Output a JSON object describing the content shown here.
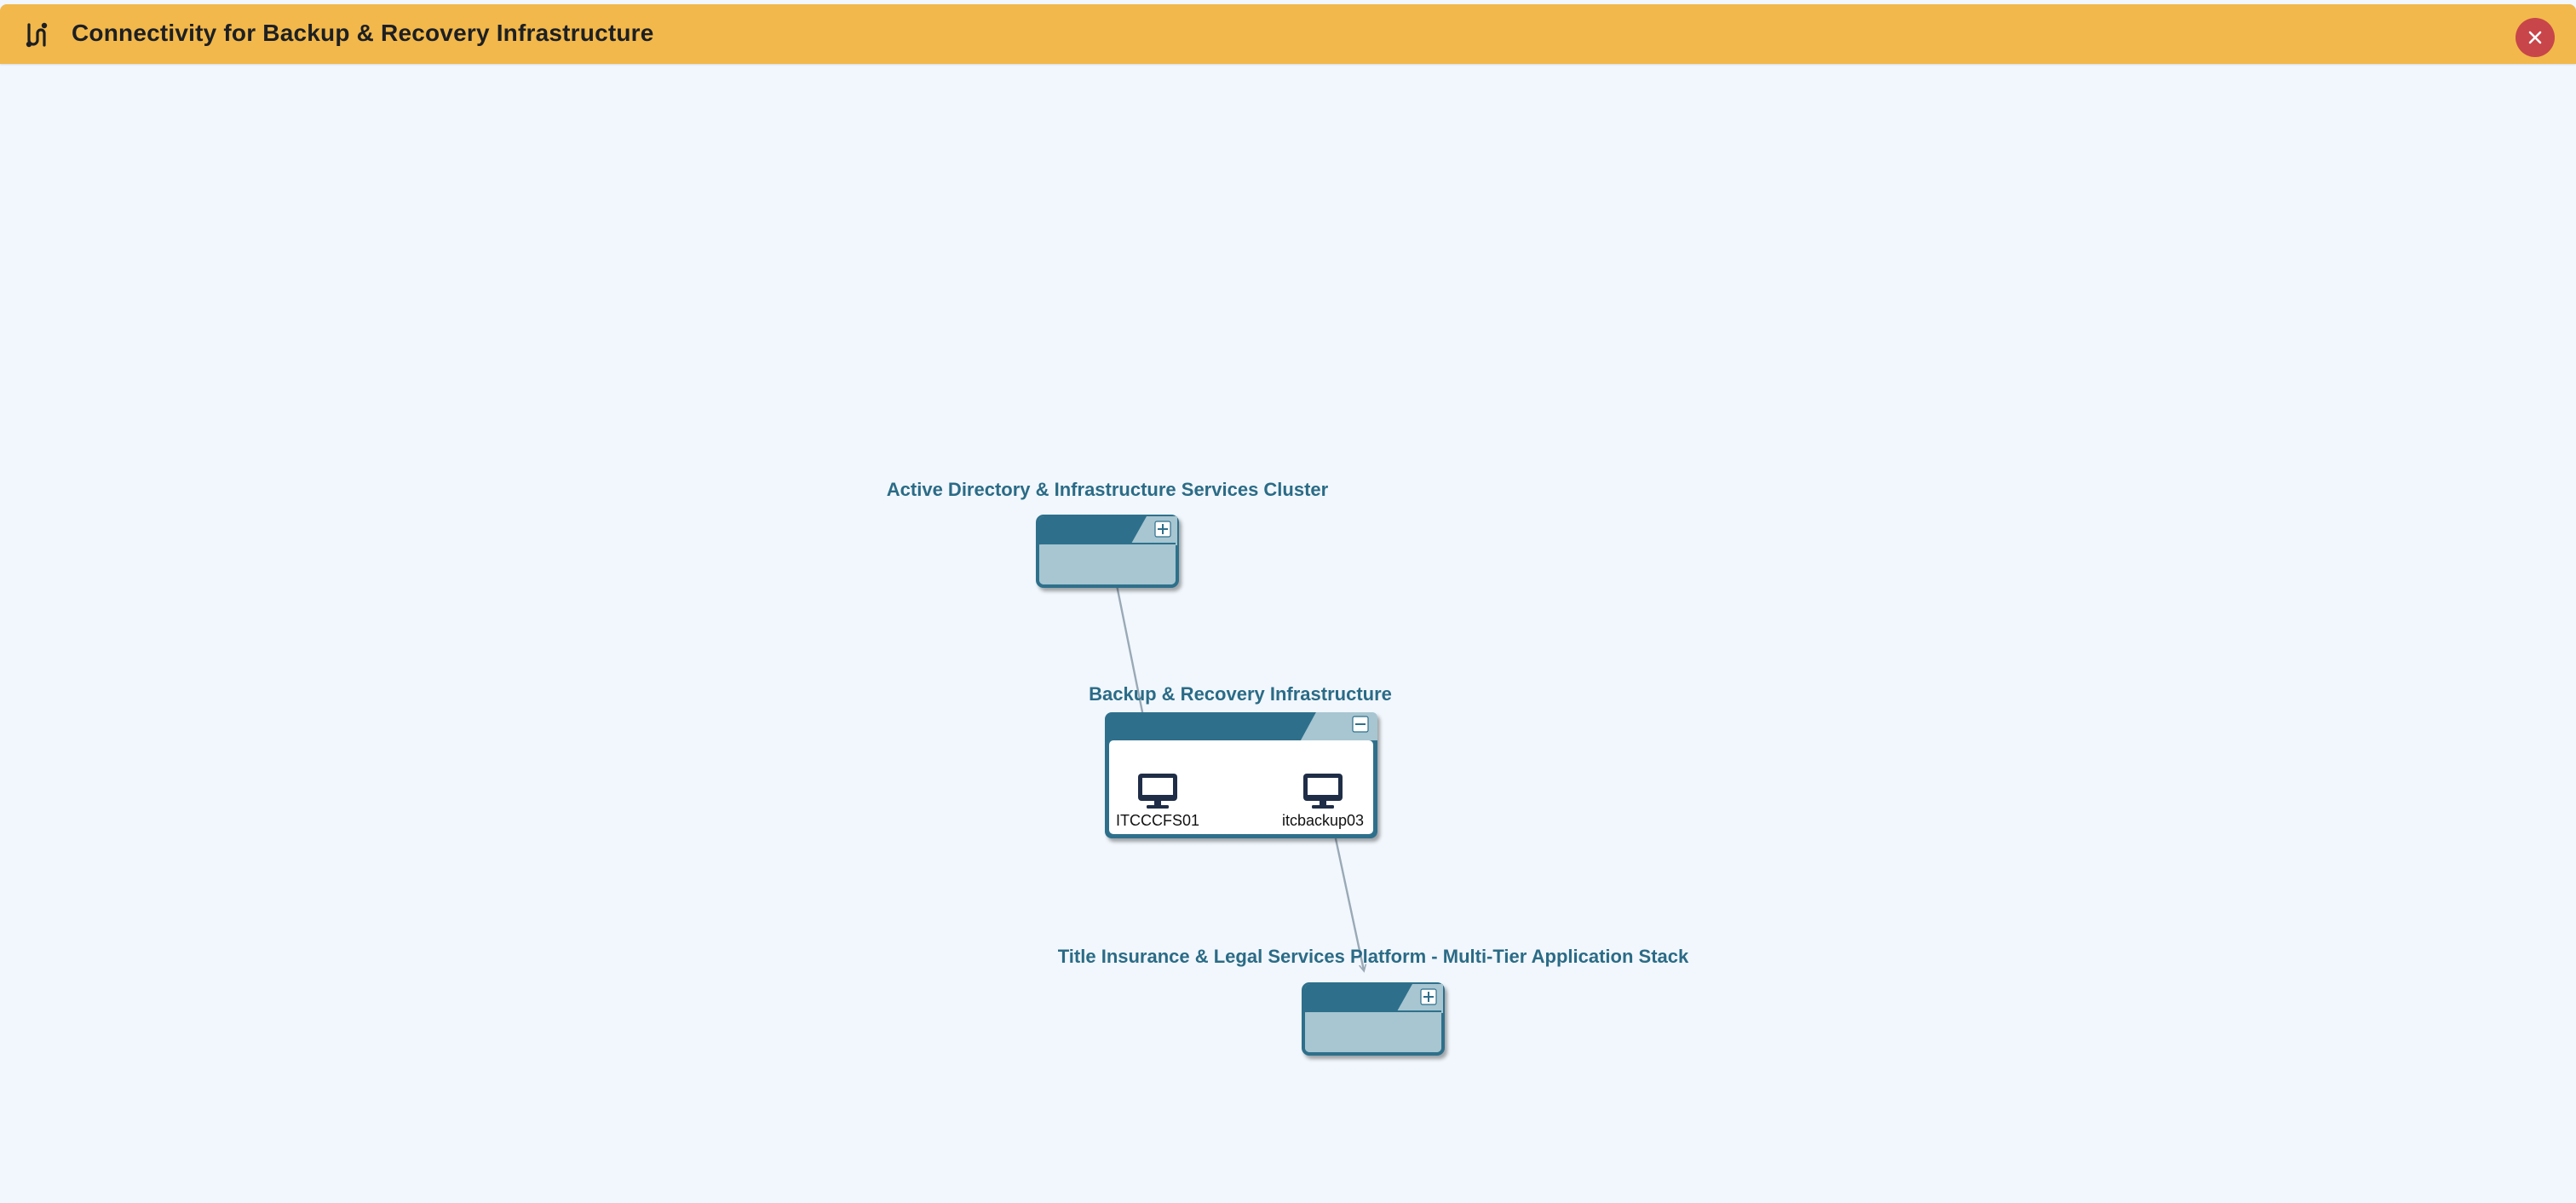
{
  "window": {
    "title": "Connectivity for Backup & Recovery Infrastructure",
    "title_icon": "connectivity-route-icon",
    "close_icon": "close-icon",
    "titlebar_color": "#f2b84b",
    "close_color": "#c8454a"
  },
  "groups": [
    {
      "id": "ad",
      "label": "Active Directory & Infrastructure Services Cluster",
      "state": "collapsed",
      "toggle_icon": "expand-plus-icon"
    },
    {
      "id": "backup",
      "label": "Backup & Recovery Infrastructure",
      "state": "expanded",
      "toggle_icon": "collapse-minus-icon",
      "nodes": [
        {
          "label": "ITCCCFS01",
          "icon": "desktop-monitor-icon"
        },
        {
          "label": "itcbackup03",
          "icon": "desktop-monitor-icon"
        }
      ]
    },
    {
      "id": "title",
      "label": "Title Insurance & Legal Services Platform - Multi-Tier Application Stack",
      "state": "collapsed",
      "toggle_icon": "expand-plus-icon"
    }
  ],
  "connections": [
    {
      "from": "ad",
      "to": "ITCCCFS01"
    },
    {
      "from": "itcbackup03",
      "to": "title"
    }
  ],
  "colors": {
    "group_tab": "#2f6f8b",
    "group_body": "#a7c6d1",
    "group_label": "#2b6b86",
    "node_icon": "#1f2d47",
    "edge": "#9aa9b6"
  }
}
